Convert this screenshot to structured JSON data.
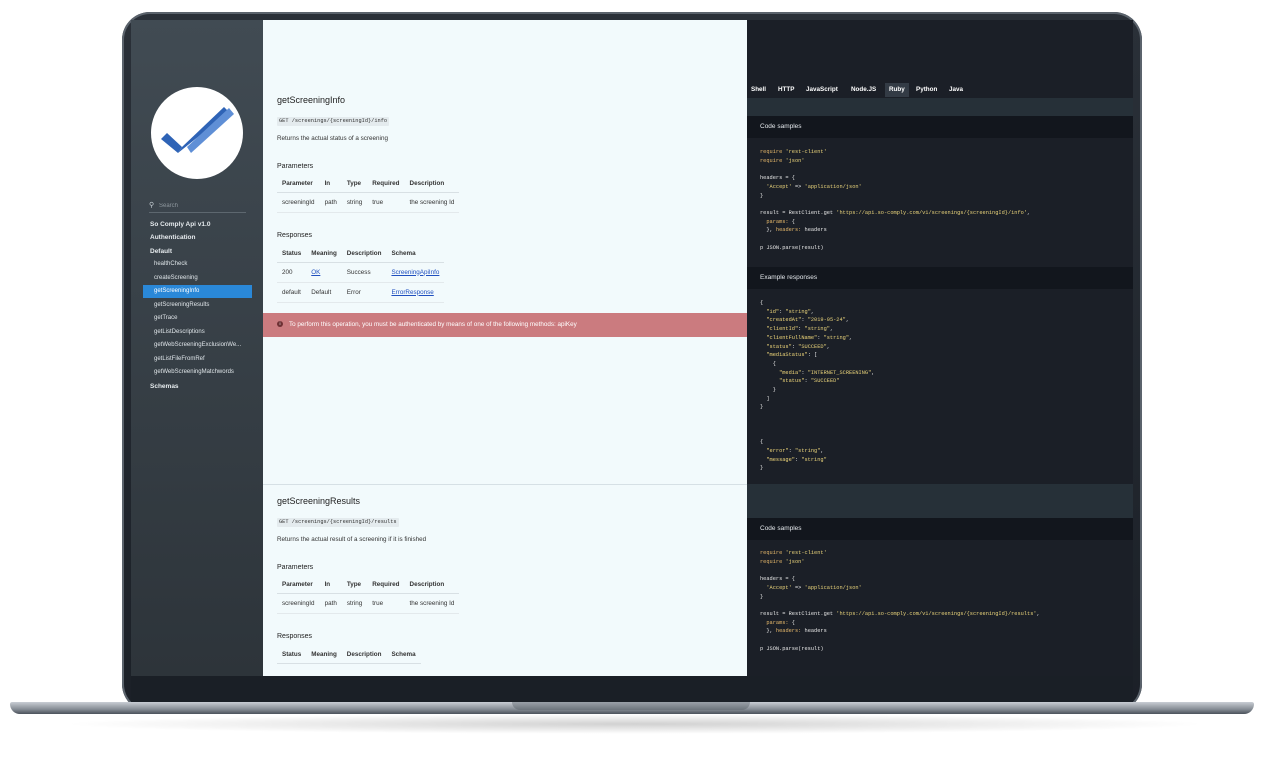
{
  "sidebar": {
    "search_placeholder": "Search",
    "api_title": "So Comply Api v1.0",
    "authentication": "Authentication",
    "default_group": "Default",
    "items": [
      "healthCheck",
      "createScreening",
      "getScreeningInfo",
      "getScreeningResults",
      "getTrace",
      "getListDescriptions",
      "getWebScreeningExclusionWe...",
      "getListFileFromRef",
      "getWebScreeningMatchwords"
    ],
    "active_item": "getScreeningInfo",
    "schemas": "Schemas"
  },
  "op1": {
    "title": "getScreeningInfo",
    "endpoint": "GET /screenings/{screeningId}/info",
    "description": "Returns the actual status of a screening",
    "params_heading": "Parameters",
    "params_headers": [
      "Parameter",
      "In",
      "Type",
      "Required",
      "Description"
    ],
    "params_row": [
      "screeningId",
      "path",
      "string",
      "true",
      "the screening Id"
    ],
    "responses_heading": "Responses",
    "resp_headers": [
      "Status",
      "Meaning",
      "Description",
      "Schema"
    ],
    "resp_rows": [
      [
        "200",
        "OK",
        "Success",
        "ScreeningApiInfo"
      ],
      [
        "default",
        "Default",
        "Error",
        "ErrorResponse"
      ]
    ],
    "auth_notice": "To perform this operation, you must be authenticated by means of one of the following methods: apiKey"
  },
  "op2": {
    "title": "getScreeningResults",
    "endpoint": "GET /screenings/{screeningId}/results",
    "description": "Returns the actual result of a screening if it is finished",
    "params_heading": "Parameters",
    "params_headers": [
      "Parameter",
      "In",
      "Type",
      "Required",
      "Description"
    ],
    "params_row": [
      "screeningId",
      "path",
      "string",
      "true",
      "the screening Id"
    ],
    "responses_heading": "Responses",
    "resp_headers": [
      "Status",
      "Meaning",
      "Description",
      "Schema"
    ]
  },
  "right": {
    "tabs": [
      "Shell",
      "HTTP",
      "JavaScript",
      "Node.JS",
      "Ruby",
      "Python",
      "Java"
    ],
    "active_tab": "Ruby",
    "code_samples_label": "Code samples",
    "example_responses_label": "Example responses",
    "url1": "'https://api.so-comply.com/v1/screenings/{screeningId}/info'",
    "url2": "'https://api.so-comply.com/v1/screenings/{screeningId}/results'",
    "example_date": "\"2019-05-24\""
  },
  "colors": {
    "accent": "#2a88d8",
    "alert": "#cb7b7f",
    "link": "#1f4fbf"
  }
}
